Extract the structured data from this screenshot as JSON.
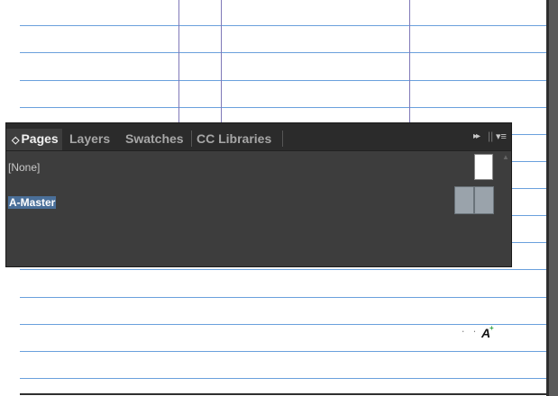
{
  "document": {
    "cursor_text": "·  ·",
    "type_tool_icon": "A",
    "type_tool_badge": "+"
  },
  "panel": {
    "tabs": [
      {
        "label": "Pages",
        "active": true
      },
      {
        "label": "Layers",
        "active": false
      },
      {
        "label": "Swatches",
        "active": false
      },
      {
        "label": "CC Libraries",
        "active": false
      }
    ],
    "tab_arrows_glyph": "◇",
    "collapse_glyph": "▸▸",
    "grip_glyph": "||",
    "menu_glyph": "▾≡",
    "masters": [
      {
        "label": "[None]",
        "selected": false
      },
      {
        "label": "A-Master",
        "selected": true
      }
    ]
  },
  "colors": {
    "guide": "#6aa0dc",
    "column_guide": "#7f78b8",
    "panel_bg": "#3d3d3d",
    "tabbar_bg": "#2b2b2b",
    "selection": "#4a6f99"
  }
}
